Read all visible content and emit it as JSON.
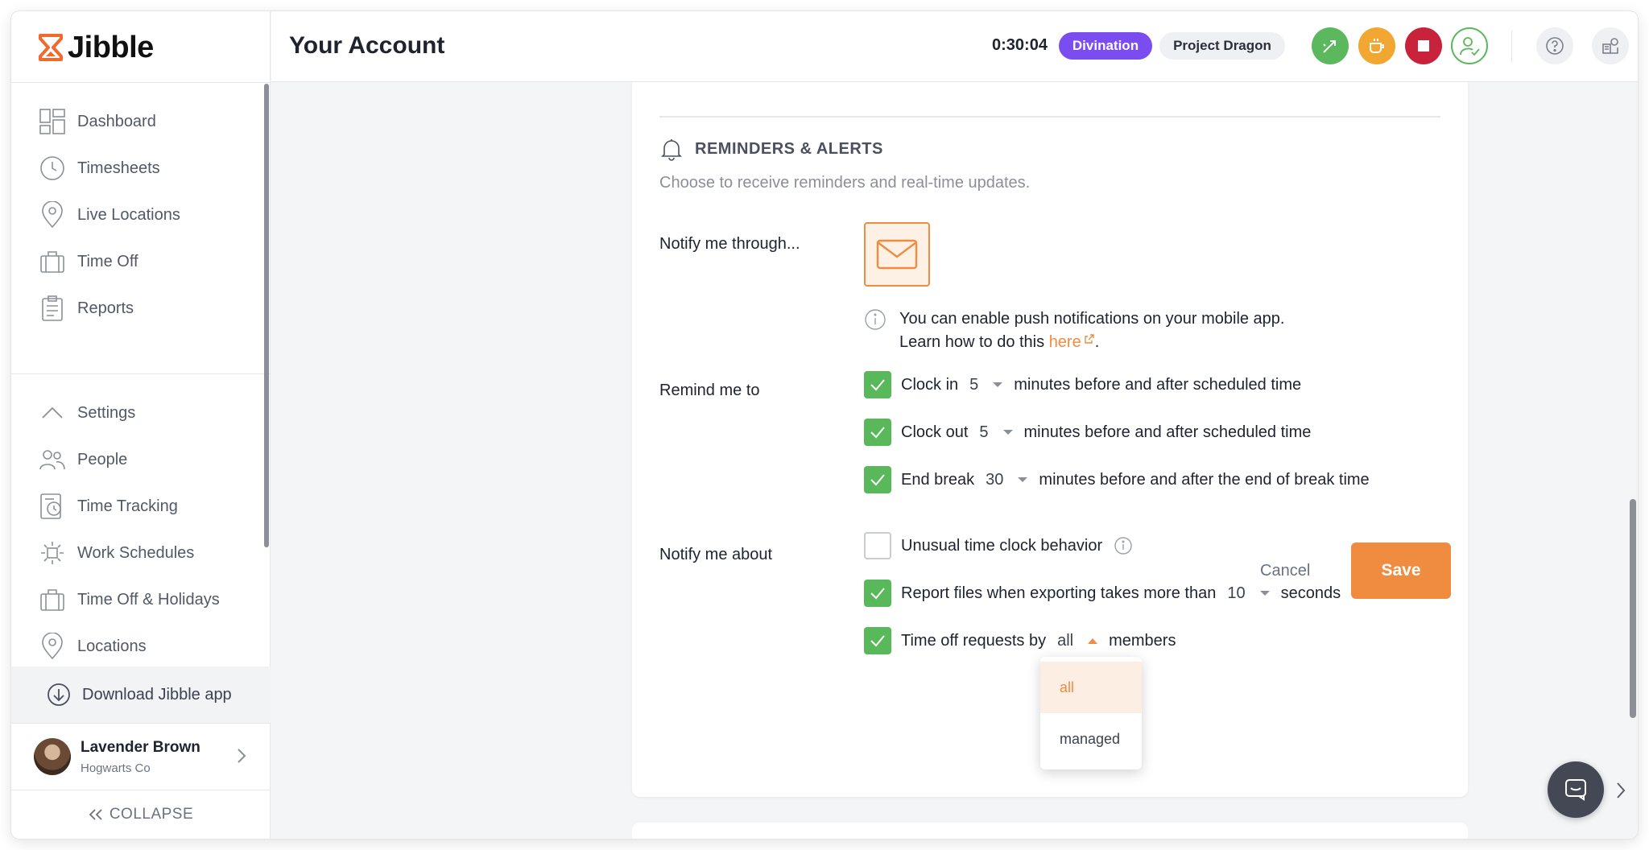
{
  "app": {
    "name": "Jibble"
  },
  "sidebar": {
    "nav_primary": [
      {
        "label": "Dashboard",
        "icon": "dashboard-icon"
      },
      {
        "label": "Timesheets",
        "icon": "clock-icon"
      },
      {
        "label": "Live Locations",
        "icon": "location-pin-icon"
      },
      {
        "label": "Time Off",
        "icon": "suitcase-icon"
      },
      {
        "label": "Reports",
        "icon": "clipboard-icon"
      }
    ],
    "nav_secondary": [
      {
        "label": "Settings",
        "icon": "chevron-up-icon"
      },
      {
        "label": "People",
        "icon": "people-icon"
      },
      {
        "label": "Time Tracking",
        "icon": "time-tracking-icon"
      },
      {
        "label": "Work Schedules",
        "icon": "sun-schedule-icon"
      },
      {
        "label": "Time Off & Holidays",
        "icon": "suitcase-icon"
      },
      {
        "label": "Locations",
        "icon": "location-pin-icon"
      }
    ],
    "download_label": "Download Jibble app",
    "user": {
      "name": "Lavender Brown",
      "org": "Hogwarts Co"
    },
    "collapse_label": "COLLAPSE"
  },
  "header": {
    "title": "Your Account",
    "timer": "0:30:04",
    "activity": "Divination",
    "project": "Project Dragon",
    "colors": {
      "activity": "#7b4cf0",
      "switch": "#5cb85c",
      "break": "#f3a733",
      "stop": "#c8233a"
    }
  },
  "reminders": {
    "title": "REMINDERS & ALERTS",
    "description": "Choose to receive reminders and real-time updates.",
    "notify_through_label": "Notify me through...",
    "info_line1": "You can enable push notifications on your mobile app.",
    "info_line2_prefix": "Learn how to do this ",
    "info_link": "here",
    "info_line2_suffix": ".",
    "remind_label": "Remind me to",
    "remind_items": [
      {
        "checked": true,
        "label": "Clock in",
        "value": "5",
        "suffix": "minutes before and after scheduled time"
      },
      {
        "checked": true,
        "label": "Clock out",
        "value": "5",
        "suffix": "minutes before and after scheduled time"
      },
      {
        "checked": true,
        "label": "End break",
        "value": "30",
        "suffix": "minutes before and after the end of break time"
      }
    ],
    "notify_about_label": "Notify me about",
    "unusual": {
      "checked": false,
      "label": "Unusual time clock behavior"
    },
    "report_files": {
      "checked": true,
      "label": "Report files when exporting takes more than",
      "value": "10",
      "suffix": "seconds"
    },
    "time_off": {
      "checked": true,
      "label": "Time off requests by",
      "value": "all",
      "suffix": "members"
    },
    "dropdown_options": [
      "all",
      "managed"
    ],
    "cancel_label": "Cancel",
    "save_label": "Save"
  },
  "colors": {
    "accent": "#f08c3f",
    "check": "#59b85a"
  }
}
